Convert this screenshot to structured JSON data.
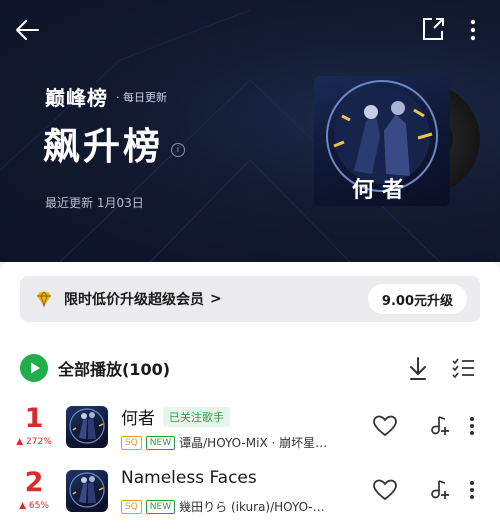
{
  "header": {
    "brand": "巅峰榜",
    "brand_sub": "· 每日更新",
    "title": "飙升榜",
    "info_glyph": "i",
    "updated": "最近更新 1月03日",
    "cover_title": "何者"
  },
  "vip": {
    "text": "限时低价升级超级会员",
    "chevron": ">",
    "button": "9.00元升级"
  },
  "playall": {
    "label": "全部播放(100)"
  },
  "songs": [
    {
      "rank": "1",
      "change": "▲ 272%",
      "title": "何者",
      "follow": "已关注歌手",
      "tag_sq": "SQ",
      "tag_new": "NEW",
      "artist": "谭晶/HOYO-MiX · 崩坏星…"
    },
    {
      "rank": "2",
      "change": "▲ 65%",
      "title": "Nameless Faces",
      "tag_sq": "SQ",
      "tag_new": "NEW",
      "artist": "幾田りら (ikura)/HOYO-…"
    }
  ],
  "colors": {
    "header_bg": "#121a30",
    "accent_green": "#1fae4b",
    "rank_red": "#d92b2b"
  }
}
